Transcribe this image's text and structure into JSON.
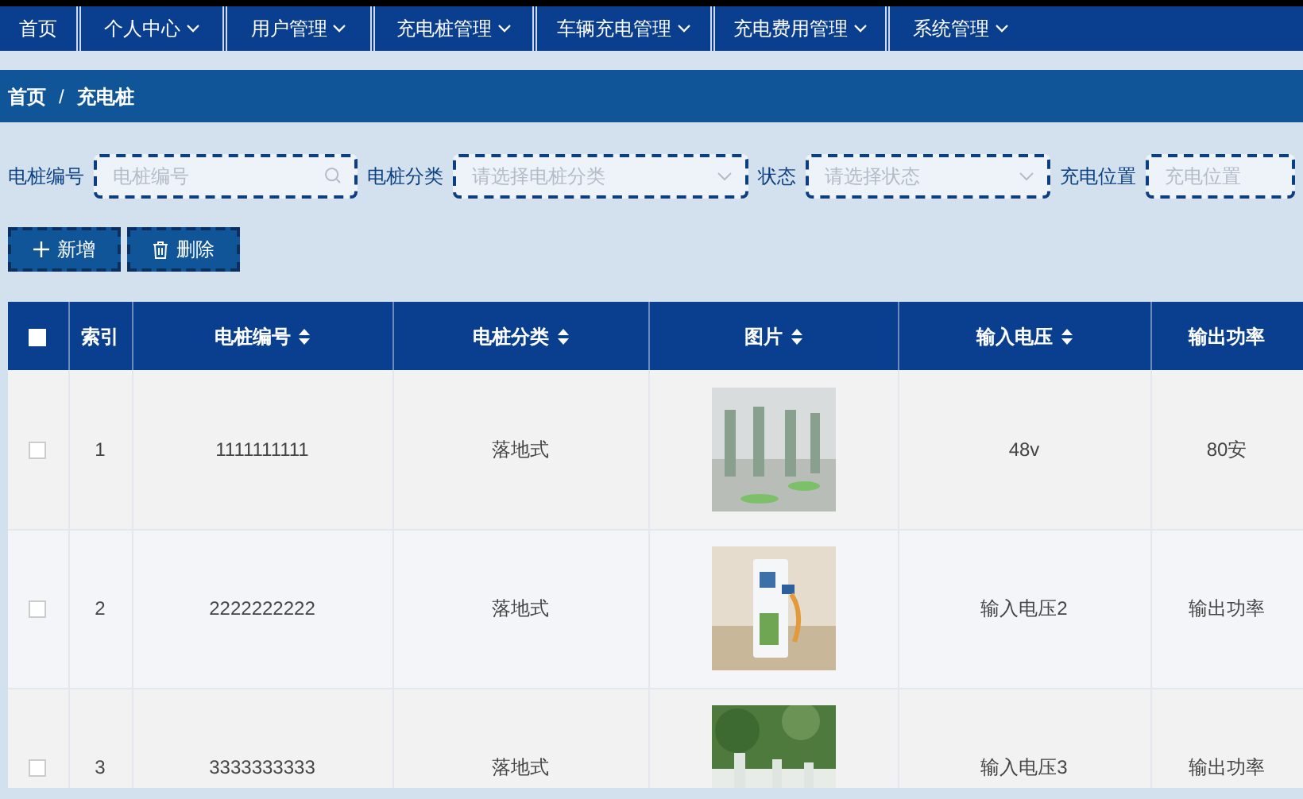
{
  "nav": [
    {
      "label": "首页",
      "dropdown": false
    },
    {
      "label": "个人中心",
      "dropdown": true
    },
    {
      "label": "用户管理",
      "dropdown": true
    },
    {
      "label": "充电桩管理",
      "dropdown": true
    },
    {
      "label": "车辆充电管理",
      "dropdown": true
    },
    {
      "label": "充电费用管理",
      "dropdown": true
    },
    {
      "label": "系统管理",
      "dropdown": true
    }
  ],
  "breadcrumb": {
    "items": [
      "首页",
      "充电桩"
    ],
    "separator": "/"
  },
  "filters": [
    {
      "label": "电桩编号",
      "placeholder": "电桩编号",
      "kind": "search"
    },
    {
      "label": "电桩分类",
      "placeholder": "请选择电桩分类",
      "kind": "select"
    },
    {
      "label": "状态",
      "placeholder": "请选择状态",
      "kind": "select"
    },
    {
      "label": "充电位置",
      "placeholder": "充电位置",
      "kind": "text"
    }
  ],
  "buttons": [
    {
      "label": "新增",
      "kind": "add"
    },
    {
      "label": "删除",
      "kind": "delete"
    }
  ],
  "table": {
    "all_checked": false,
    "columns": [
      {
        "label": "索引",
        "sortable": false
      },
      {
        "label": "电桩编号",
        "sortable": true
      },
      {
        "label": "电桩分类",
        "sortable": true
      },
      {
        "label": "图片",
        "sortable": true
      },
      {
        "label": "输入电压",
        "sortable": true
      },
      {
        "label": "输出功率",
        "sortable": false
      }
    ],
    "rows": [
      {
        "checked": false,
        "index": "1",
        "code": "1111111111",
        "category": "落地式",
        "voltage": "48v",
        "power": "80安"
      },
      {
        "checked": false,
        "index": "2",
        "code": "2222222222",
        "category": "落地式",
        "voltage": "输入电压2",
        "power": "输出功率"
      },
      {
        "checked": false,
        "index": "3",
        "code": "3333333333",
        "category": "落地式",
        "voltage": "输入电压3",
        "power": "输出功率"
      }
    ]
  }
}
